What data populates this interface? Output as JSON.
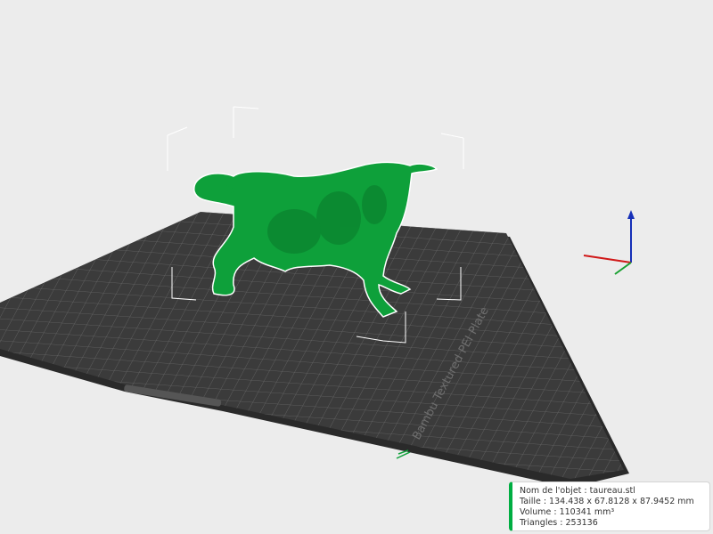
{
  "plate": {
    "label": "Bambu Textured PEI Plate"
  },
  "object_info": {
    "name": "Nom de l'objet : taureau.stl",
    "size": "Taille : 134.438 x 67.8128 x 87.9452 mm",
    "volume": "Volume : 110341 mm³",
    "triangles": "Triangles : 253136"
  },
  "colors": {
    "model": "#0ea03a",
    "accent": "#00ae42",
    "bed": "#3a3a3a",
    "background": "#ececec"
  }
}
